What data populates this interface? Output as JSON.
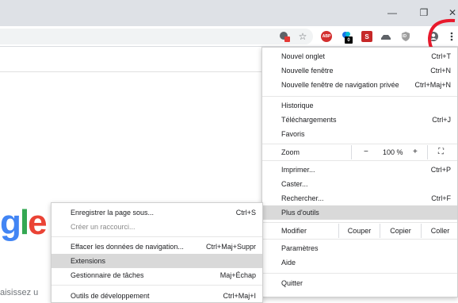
{
  "window": {
    "minimize_glyph": "—",
    "restore_glyph": "❐",
    "close_glyph": "✕"
  },
  "toolbar": {
    "icons": [
      "translate-icon",
      "star-icon",
      "abp-icon",
      "extension-badge-icon",
      "extension-red-icon",
      "extension-car-icon",
      "extension-shield-icon",
      "profile-icon",
      "kebab-menu-icon"
    ],
    "abp_label": "ABP",
    "badge_count": "0",
    "shield_label": "ID"
  },
  "page": {
    "google_fragment": [
      "g",
      "l",
      "e"
    ],
    "search_fragment": "aisissez u"
  },
  "main_menu": {
    "items": [
      {
        "label": "Nouvel onglet",
        "shortcut": "Ctrl+T"
      },
      {
        "label": "Nouvelle fenêtre",
        "shortcut": "Ctrl+N"
      },
      {
        "label": "Nouvelle fenêtre de navigation privée",
        "shortcut": "Ctrl+Maj+N"
      },
      {
        "label": "Historique",
        "shortcut": ""
      },
      {
        "label": "Téléchargements",
        "shortcut": "Ctrl+J"
      },
      {
        "label": "Favoris",
        "shortcut": ""
      },
      {
        "label": "Imprimer...",
        "shortcut": "Ctrl+P"
      },
      {
        "label": "Caster...",
        "shortcut": ""
      },
      {
        "label": "Rechercher...",
        "shortcut": "Ctrl+F"
      },
      {
        "label": "Plus d'outils",
        "shortcut": ""
      },
      {
        "label": "Paramètres",
        "shortcut": ""
      },
      {
        "label": "Aide",
        "shortcut": ""
      },
      {
        "label": "Quitter",
        "shortcut": ""
      }
    ],
    "zoom": {
      "label": "Zoom",
      "minus": "−",
      "value": "100 %",
      "plus": "+",
      "fullscreen_glyph": "⛶"
    },
    "edit": {
      "label": "Modifier",
      "cut": "Couper",
      "copy": "Copier",
      "paste": "Coller"
    }
  },
  "submenu": {
    "items": [
      {
        "label": "Enregistrer la page sous...",
        "shortcut": "Ctrl+S"
      },
      {
        "label": "Créer un raccourci...",
        "shortcut": ""
      },
      {
        "label": "Effacer les données de navigation...",
        "shortcut": "Ctrl+Maj+Suppr"
      },
      {
        "label": "Extensions",
        "shortcut": ""
      },
      {
        "label": "Gestionnaire de tâches",
        "shortcut": "Maj+Échap"
      },
      {
        "label": "Outils de développement",
        "shortcut": "Ctrl+Maj+I"
      }
    ]
  },
  "colors": {
    "annotation_red": "#e8192c",
    "google_blue": "#4285f4",
    "google_green": "#34a853",
    "google_red": "#ea4335"
  }
}
